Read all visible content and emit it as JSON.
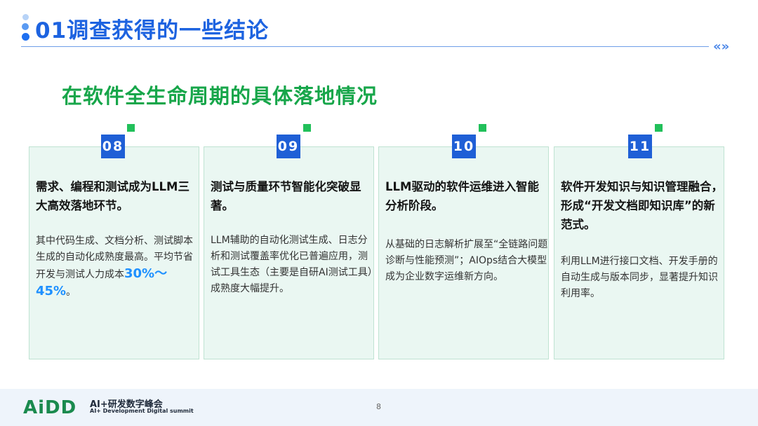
{
  "header": {
    "title": "01调查获得的一些结论",
    "nav_arrows": "«»"
  },
  "subtitle": "在软件全生命周期的具体落地情况",
  "cards": [
    {
      "number": "08",
      "heading": "需求、编程和测试成为LLM三大高效落地环节。",
      "body": "其中代码生成、文档分析、测试脚本生成的自动化成熟度最高。平均节省开发与测试人力成本",
      "highlight": "30%～45%",
      "body_end": "。"
    },
    {
      "number": "09",
      "heading": "测试与质量环节智能化突破显著。",
      "body": "LLM辅助的自动化测试生成、日志分析和测试覆盖率优化已普遍应用，测试工具生态（主要是自研AI测试工具）成熟度大幅提升。"
    },
    {
      "number": "10",
      "heading": "LLM驱动的软件运维进入智能分析阶段。",
      "body": "从基础的日志解析扩展至“全链路问题诊断与性能预测”；AIOps结合大模型成为企业数字运维新方向。"
    },
    {
      "number": "11",
      "heading": "软件开发知识与知识管理融合，形成“开发文档即知识库”的新范式。",
      "body": "利用LLM进行接口文档、开发手册的自动生成与版本同步，显著提升知识利用率。"
    }
  ],
  "footer": {
    "logo": "AiDD",
    "logo_title": "AI+研发数字峰会",
    "logo_subtitle": "AI+ Development Digital summit",
    "page_number": "8"
  }
}
